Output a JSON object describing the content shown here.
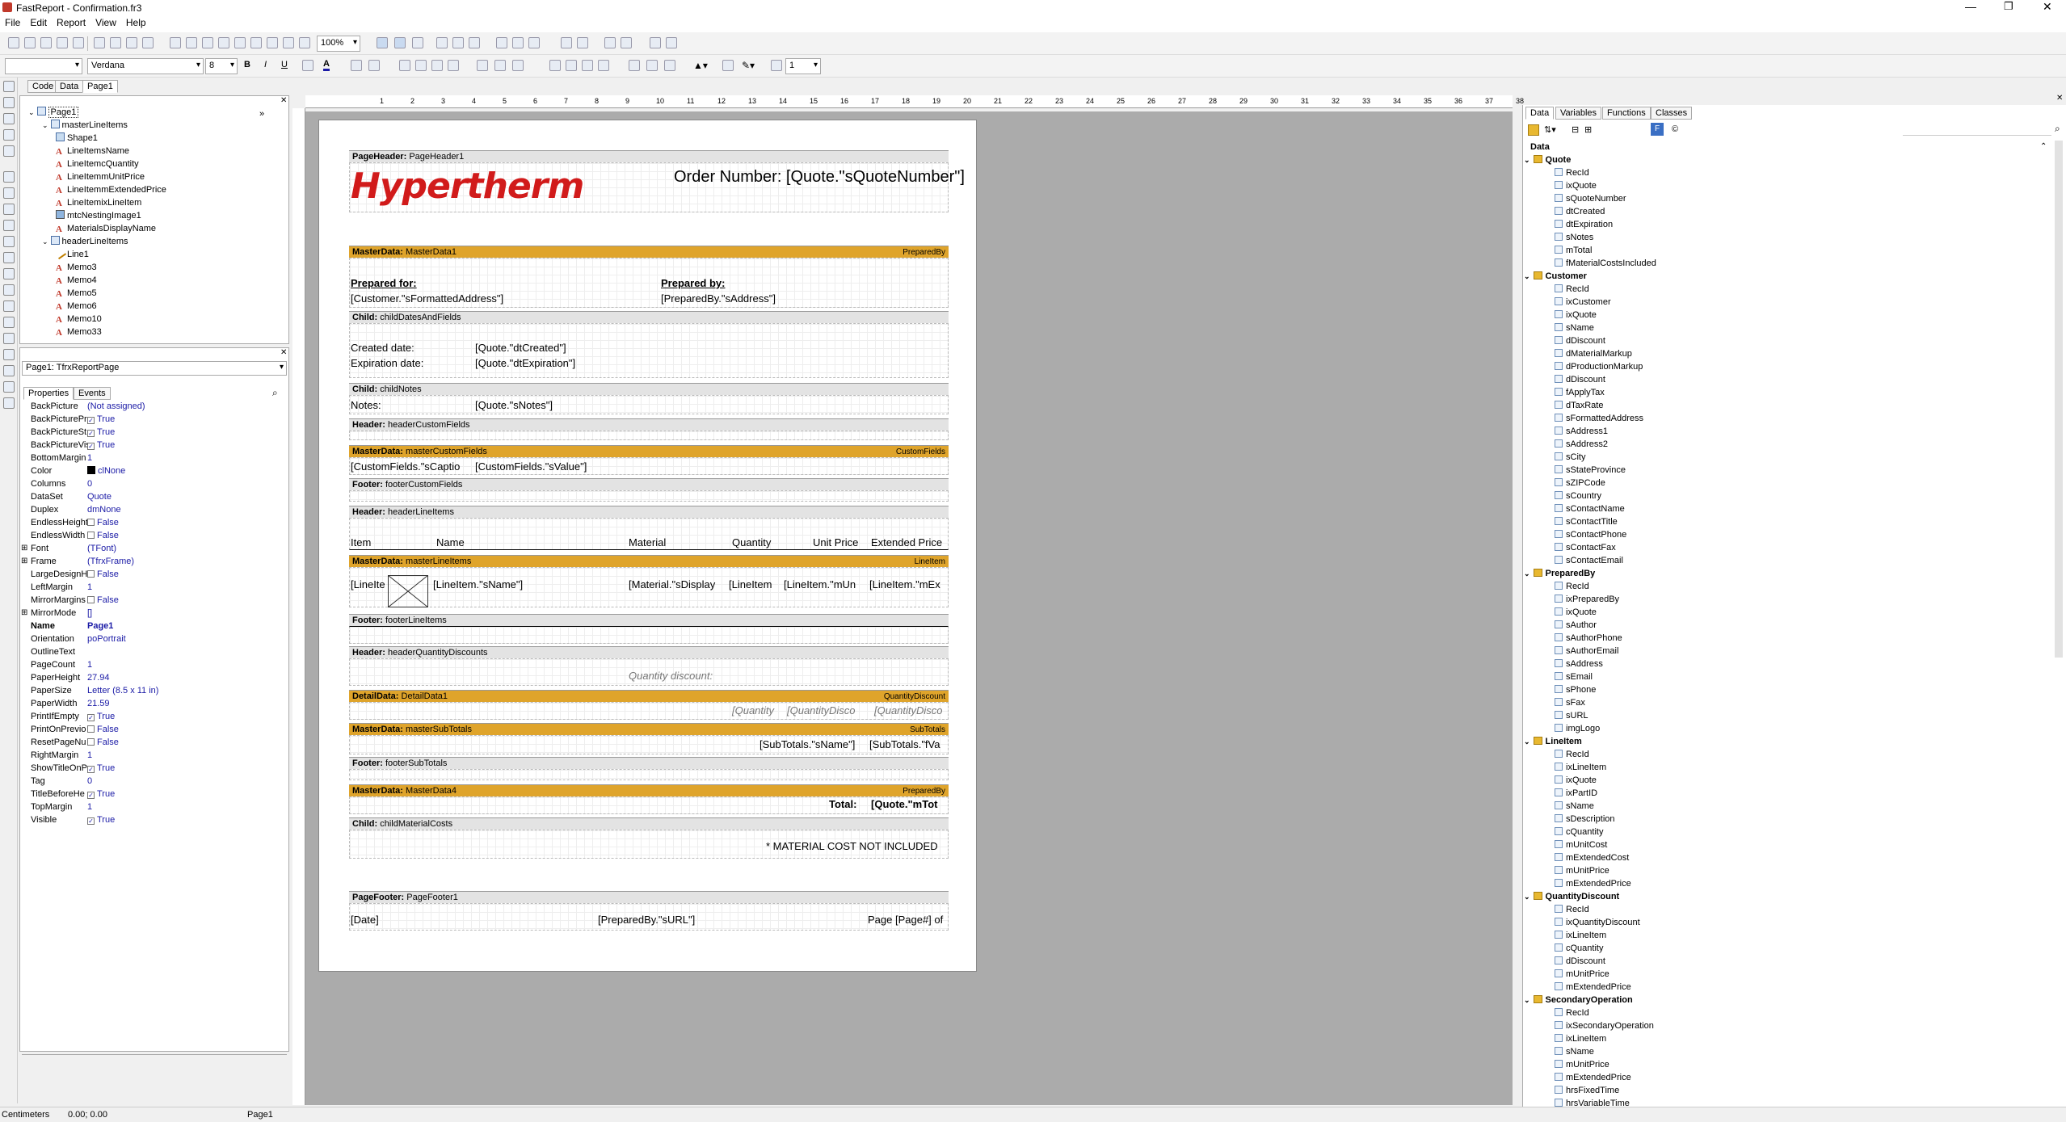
{
  "window": {
    "title": "FastReport - Confirmation.fr3"
  },
  "menu": [
    "File",
    "Edit",
    "Report",
    "View",
    "Help"
  ],
  "toolbar": {
    "zoom": "100%",
    "font": "Verdana",
    "size": "8",
    "line_width": "1"
  },
  "editor_tabs": [
    "Code",
    "Data",
    "Page1"
  ],
  "tree": [
    {
      "label": "Page1",
      "level": 0,
      "icon": "page"
    },
    {
      "label": "masterLineItems",
      "level": 1,
      "icon": "band"
    },
    {
      "label": "Shape1",
      "level": 2,
      "icon": "shape"
    },
    {
      "label": "LineItemsName",
      "level": 2,
      "icon": "text"
    },
    {
      "label": "LineItemcQuantity",
      "level": 2,
      "icon": "text"
    },
    {
      "label": "LineItemmUnitPrice",
      "level": 2,
      "icon": "text"
    },
    {
      "label": "LineItemmExtendedPrice",
      "level": 2,
      "icon": "text"
    },
    {
      "label": "LineItemixLineItem",
      "level": 2,
      "icon": "text"
    },
    {
      "label": "mtcNestingImage1",
      "level": 2,
      "icon": "picture"
    },
    {
      "label": "MaterialsDisplayName",
      "level": 2,
      "icon": "text"
    },
    {
      "label": "headerLineItems",
      "level": 1,
      "icon": "band"
    },
    {
      "label": "Line1",
      "level": 2,
      "icon": "line"
    },
    {
      "label": "Memo3",
      "level": 2,
      "icon": "text"
    },
    {
      "label": "Memo4",
      "level": 2,
      "icon": "text"
    },
    {
      "label": "Memo5",
      "level": 2,
      "icon": "text"
    },
    {
      "label": "Memo6",
      "level": 2,
      "icon": "text"
    },
    {
      "label": "Memo10",
      "level": 2,
      "icon": "text"
    },
    {
      "label": "Memo33",
      "level": 2,
      "icon": "text"
    }
  ],
  "object_selector": "Page1: TfrxReportPage",
  "inspector_tabs": [
    "Properties",
    "Events"
  ],
  "properties": [
    {
      "name": "BackPicture",
      "value": "(Not assigned)"
    },
    {
      "name": "BackPicturePri",
      "value": "True",
      "check": true
    },
    {
      "name": "BackPictureSt",
      "value": "True",
      "check": true
    },
    {
      "name": "BackPictureVis",
      "value": "True",
      "check": true
    },
    {
      "name": "BottomMargin",
      "value": "1"
    },
    {
      "name": "Color",
      "value": "clNone",
      "swatch": true
    },
    {
      "name": "Columns",
      "value": "0"
    },
    {
      "name": "DataSet",
      "value": "Quote"
    },
    {
      "name": "Duplex",
      "value": "dmNone"
    },
    {
      "name": "EndlessHeight",
      "value": "False",
      "check": false
    },
    {
      "name": "EndlessWidth",
      "value": "False",
      "check": false
    },
    {
      "name": "Font",
      "value": "(TFont)",
      "expand": true
    },
    {
      "name": "Frame",
      "value": "(TfrxFrame)",
      "expand": true
    },
    {
      "name": "LargeDesignH",
      "value": "False",
      "check": false
    },
    {
      "name": "LeftMargin",
      "value": "1"
    },
    {
      "name": "MirrorMargins",
      "value": "False",
      "check": false
    },
    {
      "name": "MirrorMode",
      "value": "[]",
      "expand": true
    },
    {
      "name": "Name",
      "value": "Page1",
      "bold": true
    },
    {
      "name": "Orientation",
      "value": "poPortrait"
    },
    {
      "name": "OutlineText",
      "value": ""
    },
    {
      "name": "PageCount",
      "value": "1"
    },
    {
      "name": "PaperHeight",
      "value": "27.94"
    },
    {
      "name": "PaperSize",
      "value": "Letter (8.5 x 11 in)"
    },
    {
      "name": "PaperWidth",
      "value": "21.59"
    },
    {
      "name": "PrintIfEmpty",
      "value": "True",
      "check": true
    },
    {
      "name": "PrintOnPrevio",
      "value": "False",
      "check": false
    },
    {
      "name": "ResetPageNu",
      "value": "False",
      "check": false
    },
    {
      "name": "RightMargin",
      "value": "1"
    },
    {
      "name": "ShowTitleOnP",
      "value": "True",
      "check": true
    },
    {
      "name": "Tag",
      "value": "0"
    },
    {
      "name": "TitleBeforeHe",
      "value": "True",
      "check": true
    },
    {
      "name": "TopMargin",
      "value": "1"
    },
    {
      "name": "Visible",
      "value": "True",
      "check": true
    }
  ],
  "ruler_labels": [
    "1",
    "2",
    "3",
    "4",
    "5",
    "6",
    "7",
    "8",
    "9",
    "10",
    "11",
    "12",
    "13",
    "14",
    "15",
    "16",
    "17",
    "18",
    "19",
    "20",
    "21",
    "22",
    "23",
    "24",
    "25",
    "26",
    "27",
    "28",
    "29",
    "30",
    "31",
    "32",
    "33",
    "34",
    "35",
    "36",
    "37",
    "38"
  ],
  "report": {
    "pageheader": {
      "header": "PageHeader1",
      "logo": "Hypertherm",
      "order": "Order Number: [Quote.\"sQuoteNumber\"]"
    },
    "masterdata1": {
      "header": "MasterData1",
      "right": "PreparedBy",
      "prepared_for": "Prepared for:",
      "customer_addr": "[Customer.\"sFormattedAddress\"]",
      "prepared_by": "Prepared by:",
      "preparedby_addr": "[PreparedBy.\"sAddress\"]"
    },
    "child_dates": {
      "header": "childDatesAndFields",
      "created_label": "Created date:",
      "expiration_label": "Expiration date:",
      "created_val": "[Quote.\"dtCreated\"]",
      "expiration_val": "[Quote.\"dtExpiration\"]"
    },
    "child_notes": {
      "header": "childNotes",
      "label": "Notes:",
      "value": "[Quote.\"sNotes\"]"
    },
    "header_custom": {
      "header": "headerCustomFields"
    },
    "master_custom": {
      "header": "masterCustomFields",
      "right": "CustomFields",
      "caption": "[CustomFields.\"sCaptio",
      "value": "[CustomFields.\"sValue\"]"
    },
    "footer_custom": {
      "header": "footerCustomFields"
    },
    "header_lineitems": {
      "header": "headerLineItems",
      "cols": [
        "Item",
        "Name",
        "Material",
        "Quantity",
        "Unit Price",
        "Extended Price"
      ]
    },
    "master_lineitems": {
      "header": "masterLineItems",
      "right": "LineItem",
      "item": "[LineIte",
      "name": "[LineItem.\"sName\"]",
      "material": "[Material.\"sDisplay",
      "qty": "[LineItem",
      "unit": "[LineItem.\"mUn",
      "ext": "[LineItem.\"mEx"
    },
    "footer_lineitems": {
      "header": "footerLineItems"
    },
    "header_qd": {
      "header": "headerQuantityDiscounts",
      "label": "Quantity discount:"
    },
    "detail1": {
      "header": "DetailData1",
      "right": "QuantityDiscount",
      "f1": "[Quantity",
      "f2": "[QuantityDisco",
      "f3": "[QuantityDisco"
    },
    "master_sub": {
      "header": "masterSubTotals",
      "right": "SubTotals",
      "name": "[SubTotals.\"sName\"]",
      "val": "[SubTotals.\"fVa"
    },
    "footer_sub": {
      "header": "footerSubTotals"
    },
    "master4": {
      "header": "MasterData4",
      "right": "PreparedBy",
      "total_label": "Total:",
      "total_val": "[Quote.\"mTot"
    },
    "child_mat": {
      "header": "childMaterialCosts",
      "note": "* MATERIAL COST NOT INCLUDED"
    },
    "pagefooter": {
      "header": "PageFooter1",
      "date": "[Date]",
      "url": "[PreparedBy.\"sURL\"]",
      "page": "Page [Page#] of"
    }
  },
  "band_types": {
    "pageheader": "PageHeader:",
    "masterdata": "MasterData:",
    "child": "Child:",
    "header": "Header:",
    "footer": "Footer:",
    "detaildata": "DetailData:",
    "pagefooter": "PageFooter:"
  },
  "data_tabs": [
    "Data",
    "Variables",
    "Functions",
    "Classes"
  ],
  "datatree_root": "Data",
  "datasets": [
    {
      "name": "Quote",
      "fields": [
        "RecId",
        "ixQuote",
        "sQuoteNumber",
        "dtCreated",
        "dtExpiration",
        "sNotes",
        "mTotal",
        "fMaterialCostsIncluded"
      ]
    },
    {
      "name": "Customer",
      "fields": [
        "RecId",
        "ixCustomer",
        "ixQuote",
        "sName",
        "dDiscount",
        "dMaterialMarkup",
        "dProductionMarkup",
        "dDiscount",
        "fApplyTax",
        "dTaxRate",
        "sFormattedAddress",
        "sAddress1",
        "sAddress2",
        "sCity",
        "sStateProvince",
        "sZIPCode",
        "sCountry",
        "sContactName",
        "sContactTitle",
        "sContactPhone",
        "sContactFax",
        "sContactEmail"
      ]
    },
    {
      "name": "PreparedBy",
      "fields": [
        "RecId",
        "ixPreparedBy",
        "ixQuote",
        "sAuthor",
        "sAuthorPhone",
        "sAuthorEmail",
        "sAddress",
        "sEmail",
        "sPhone",
        "sFax",
        "sURL",
        "imgLogo"
      ]
    },
    {
      "name": "LineItem",
      "fields": [
        "RecId",
        "ixLineItem",
        "ixQuote",
        "ixPartID",
        "sName",
        "sDescription",
        "cQuantity",
        "mUnitCost",
        "mExtendedCost",
        "mUnitPrice",
        "mExtendedPrice"
      ]
    },
    {
      "name": "QuantityDiscount",
      "fields": [
        "RecId",
        "ixQuantityDiscount",
        "ixLineItem",
        "cQuantity",
        "dDiscount",
        "mUnitPrice",
        "mExtendedPrice"
      ]
    },
    {
      "name": "SecondaryOperation",
      "fields": [
        "RecId",
        "ixSecondaryOperation",
        "ixLineItem",
        "sName",
        "mUnitPrice",
        "mExtendedPrice",
        "hrsFixedTime",
        "hrsVariableTime"
      ]
    }
  ],
  "status": {
    "units": "Centimeters",
    "coords": "0.00; 0.00",
    "page": "Page1"
  },
  "colors": {
    "band_gold": "#dfa42b",
    "logo_red": "#d11b1b"
  }
}
